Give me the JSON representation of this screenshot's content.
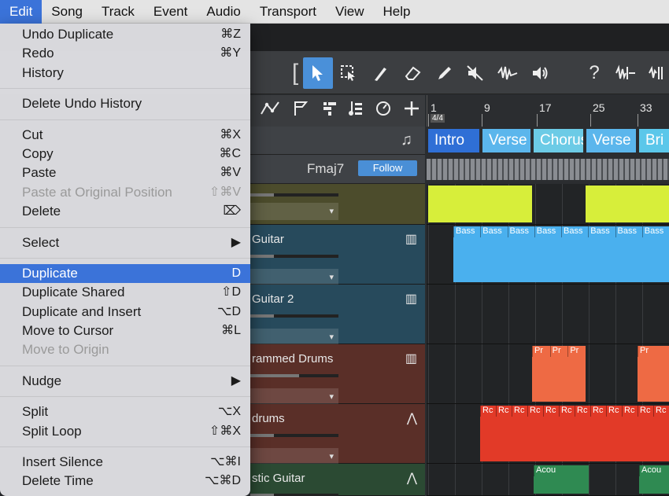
{
  "menubar": [
    "Edit",
    "Song",
    "Track",
    "Event",
    "Audio",
    "Transport",
    "View",
    "Help"
  ],
  "edit_menu": {
    "groups": [
      [
        {
          "label": "Undo Duplicate",
          "shortcut": "⌘Z"
        },
        {
          "label": "Redo",
          "shortcut": "⌘Y"
        },
        {
          "label": "History",
          "shortcut": ""
        }
      ],
      [
        {
          "label": "Delete Undo History",
          "shortcut": ""
        }
      ],
      [
        {
          "label": "Cut",
          "shortcut": "⌘X"
        },
        {
          "label": "Copy",
          "shortcut": "⌘C"
        },
        {
          "label": "Paste",
          "shortcut": "⌘V"
        },
        {
          "label": "Paste at Original Position",
          "shortcut": "⇧⌘V",
          "disabled": true
        },
        {
          "label": "Delete",
          "shortcut": "⌦"
        }
      ],
      [
        {
          "label": "Select",
          "shortcut": "▶"
        }
      ],
      [
        {
          "label": "Duplicate",
          "shortcut": "D",
          "selected": true
        },
        {
          "label": "Duplicate Shared",
          "shortcut": "⇧D"
        },
        {
          "label": "Duplicate and Insert",
          "shortcut": "⌥D"
        },
        {
          "label": "Move to Cursor",
          "shortcut": "⌘L"
        },
        {
          "label": "Move to Origin",
          "shortcut": "",
          "disabled": true
        }
      ],
      [
        {
          "label": "Nudge",
          "shortcut": "▶"
        }
      ],
      [
        {
          "label": "Split",
          "shortcut": "⌥X"
        },
        {
          "label": "Split Loop",
          "shortcut": "⇧⌘X"
        }
      ],
      [
        {
          "label": "Insert Silence",
          "shortcut": "⌥⌘I"
        },
        {
          "label": "Delete Time",
          "shortcut": "⌥⌘D"
        }
      ]
    ]
  },
  "ruler": {
    "time_signature": "4/4",
    "bars": [
      "1",
      "9",
      "17",
      "25",
      "33"
    ]
  },
  "arranger": {
    "sections": [
      {
        "label": "Intro",
        "color": "#2f6fd6"
      },
      {
        "label": "Verse",
        "color": "#5bb6ec"
      },
      {
        "label": "Chorus",
        "color": "#6ccbe6"
      },
      {
        "label": "Verse",
        "color": "#5bb6ec"
      },
      {
        "label": "Bri",
        "color": "#5bc7ea"
      }
    ]
  },
  "chord_track": {
    "chord": "Fmaj7",
    "follow_label": "Follow"
  },
  "tracks": [
    {
      "name": "",
      "icon": "",
      "color": "#4c4c2c",
      "clip_color": "#d7ee3a",
      "clip_labels": []
    },
    {
      "name": "Guitar",
      "icon": "keyboard-icon",
      "color": "#274a5c",
      "clip_color": "#4ab0ee",
      "clip_labels": [
        "Bass",
        "Bass",
        "Bass",
        "Bass",
        "Bass",
        "Bass",
        "Bass",
        "Bass"
      ]
    },
    {
      "name": "Guitar 2",
      "icon": "keyboard-icon",
      "color": "#274a5c",
      "clip_color": "",
      "clip_labels": []
    },
    {
      "name": "rammed Drums",
      "icon": "keyboard-icon",
      "color": "#5a2f28",
      "clip_color": "#ee6a44",
      "clip_labels": [
        "Pr",
        "Pr",
        "Pr",
        "Pr"
      ]
    },
    {
      "name": "drums",
      "icon": "waveform-icon",
      "color": "#5a2f28",
      "clip_color": "#e23a28",
      "clip_labels": [
        "Rc",
        "Rc",
        "Rc",
        "Rc",
        "Rc",
        "Rc",
        "Rc",
        "Rc",
        "Rc",
        "Rc",
        "Rc",
        "Rc"
      ]
    },
    {
      "name": "stic Guitar",
      "icon": "waveform-icon",
      "color": "#2b4a33",
      "clip_color": "#2f8a52",
      "clip_labels": [
        "Acou",
        "Acou"
      ]
    }
  ]
}
